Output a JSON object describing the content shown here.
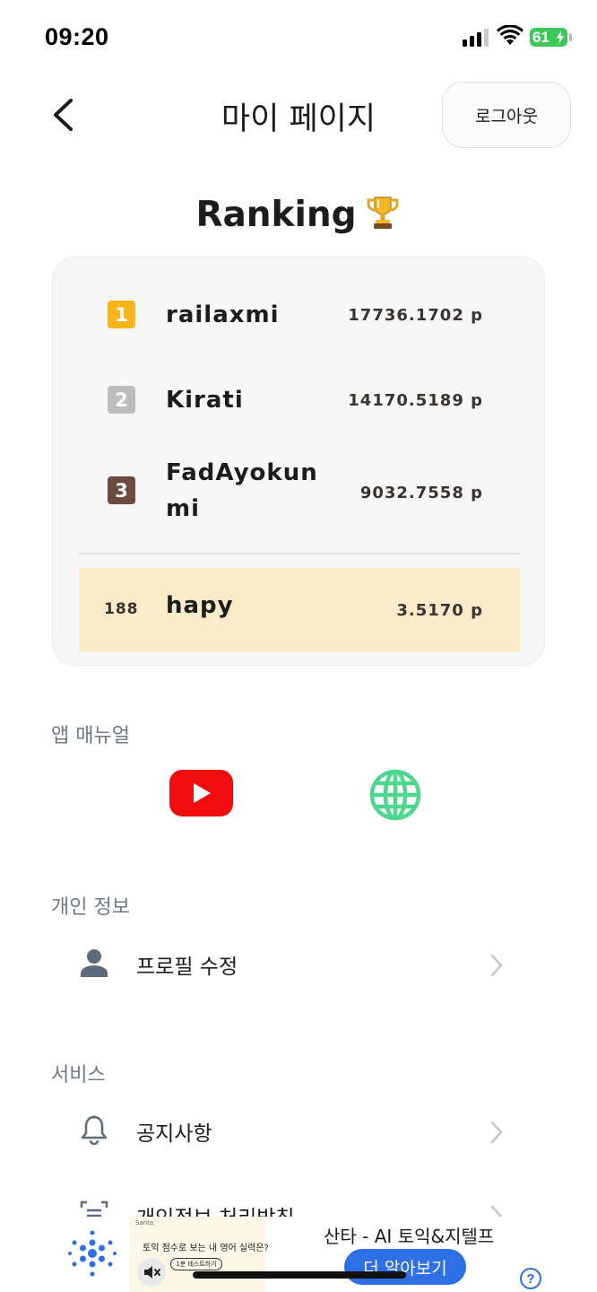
{
  "status_bar": {
    "time": "09:20",
    "battery": "61"
  },
  "header": {
    "back_icon": "chevron-left-icon",
    "title": "마이 페이지",
    "logout_label": "로그아웃"
  },
  "ranking": {
    "title": "Ranking",
    "title_icon": "trophy-icon",
    "entries": [
      {
        "rank": "1",
        "name": "railaxmi",
        "score": "17736.1702 p",
        "badge_color": "#f6b519"
      },
      {
        "rank": "2",
        "name": "Kirati",
        "score": "14170.5189 p",
        "badge_color": "#bdbdbd"
      },
      {
        "rank": "3",
        "name": "FadAyokun mi",
        "score": "9032.7558 p",
        "badge_color": "#6b4a3f"
      }
    ],
    "me": {
      "rank": "188",
      "name": "hapy",
      "score": "3.5170 p",
      "highlight_color": "#faecc9"
    }
  },
  "manual": {
    "title": "앱 매뉴얼",
    "youtube_icon": "youtube-icon",
    "web_icon": "globe-icon"
  },
  "personal": {
    "title": "개인 정보",
    "items": [
      {
        "label": "프로필 수정",
        "icon": "person-icon"
      }
    ]
  },
  "service": {
    "title": "서비스",
    "items": [
      {
        "label": "공지사항",
        "icon": "bell-icon"
      },
      {
        "label": "개인정보 처리방침",
        "icon": "document-scan-icon"
      }
    ]
  },
  "ad": {
    "title": "산타 - AI 토익&지텔프",
    "cta": "더 알아보기",
    "image_brand": "Santa",
    "image_text": "토익 점수로 보는 내 영어 실력은?",
    "image_pill": "1분 테스트하기",
    "help": "?",
    "accent": "#2f6fe6"
  }
}
